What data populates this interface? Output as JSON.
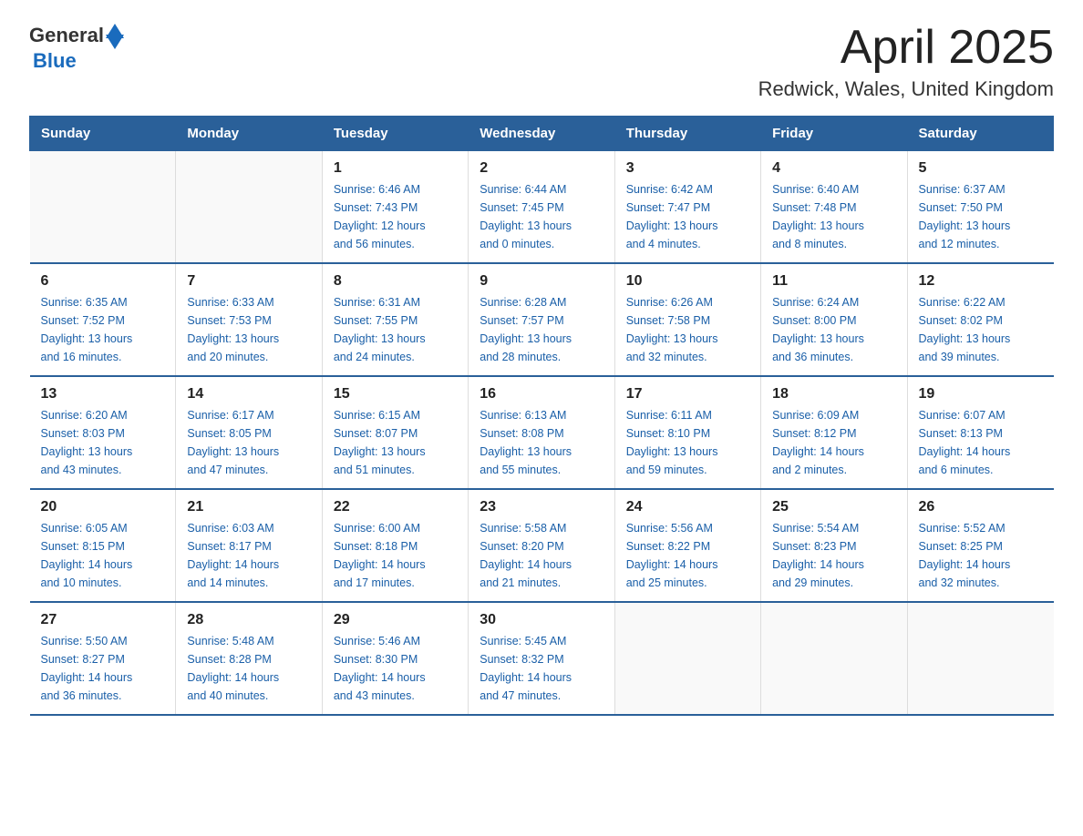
{
  "logo": {
    "text_general": "General",
    "text_blue": "Blue"
  },
  "title": "April 2025",
  "subtitle": "Redwick, Wales, United Kingdom",
  "days_of_week": [
    "Sunday",
    "Monday",
    "Tuesday",
    "Wednesday",
    "Thursday",
    "Friday",
    "Saturday"
  ],
  "weeks": [
    [
      {
        "day": "",
        "details": ""
      },
      {
        "day": "",
        "details": ""
      },
      {
        "day": "1",
        "details": "Sunrise: 6:46 AM\nSunset: 7:43 PM\nDaylight: 12 hours\nand 56 minutes."
      },
      {
        "day": "2",
        "details": "Sunrise: 6:44 AM\nSunset: 7:45 PM\nDaylight: 13 hours\nand 0 minutes."
      },
      {
        "day": "3",
        "details": "Sunrise: 6:42 AM\nSunset: 7:47 PM\nDaylight: 13 hours\nand 4 minutes."
      },
      {
        "day": "4",
        "details": "Sunrise: 6:40 AM\nSunset: 7:48 PM\nDaylight: 13 hours\nand 8 minutes."
      },
      {
        "day": "5",
        "details": "Sunrise: 6:37 AM\nSunset: 7:50 PM\nDaylight: 13 hours\nand 12 minutes."
      }
    ],
    [
      {
        "day": "6",
        "details": "Sunrise: 6:35 AM\nSunset: 7:52 PM\nDaylight: 13 hours\nand 16 minutes."
      },
      {
        "day": "7",
        "details": "Sunrise: 6:33 AM\nSunset: 7:53 PM\nDaylight: 13 hours\nand 20 minutes."
      },
      {
        "day": "8",
        "details": "Sunrise: 6:31 AM\nSunset: 7:55 PM\nDaylight: 13 hours\nand 24 minutes."
      },
      {
        "day": "9",
        "details": "Sunrise: 6:28 AM\nSunset: 7:57 PM\nDaylight: 13 hours\nand 28 minutes."
      },
      {
        "day": "10",
        "details": "Sunrise: 6:26 AM\nSunset: 7:58 PM\nDaylight: 13 hours\nand 32 minutes."
      },
      {
        "day": "11",
        "details": "Sunrise: 6:24 AM\nSunset: 8:00 PM\nDaylight: 13 hours\nand 36 minutes."
      },
      {
        "day": "12",
        "details": "Sunrise: 6:22 AM\nSunset: 8:02 PM\nDaylight: 13 hours\nand 39 minutes."
      }
    ],
    [
      {
        "day": "13",
        "details": "Sunrise: 6:20 AM\nSunset: 8:03 PM\nDaylight: 13 hours\nand 43 minutes."
      },
      {
        "day": "14",
        "details": "Sunrise: 6:17 AM\nSunset: 8:05 PM\nDaylight: 13 hours\nand 47 minutes."
      },
      {
        "day": "15",
        "details": "Sunrise: 6:15 AM\nSunset: 8:07 PM\nDaylight: 13 hours\nand 51 minutes."
      },
      {
        "day": "16",
        "details": "Sunrise: 6:13 AM\nSunset: 8:08 PM\nDaylight: 13 hours\nand 55 minutes."
      },
      {
        "day": "17",
        "details": "Sunrise: 6:11 AM\nSunset: 8:10 PM\nDaylight: 13 hours\nand 59 minutes."
      },
      {
        "day": "18",
        "details": "Sunrise: 6:09 AM\nSunset: 8:12 PM\nDaylight: 14 hours\nand 2 minutes."
      },
      {
        "day": "19",
        "details": "Sunrise: 6:07 AM\nSunset: 8:13 PM\nDaylight: 14 hours\nand 6 minutes."
      }
    ],
    [
      {
        "day": "20",
        "details": "Sunrise: 6:05 AM\nSunset: 8:15 PM\nDaylight: 14 hours\nand 10 minutes."
      },
      {
        "day": "21",
        "details": "Sunrise: 6:03 AM\nSunset: 8:17 PM\nDaylight: 14 hours\nand 14 minutes."
      },
      {
        "day": "22",
        "details": "Sunrise: 6:00 AM\nSunset: 8:18 PM\nDaylight: 14 hours\nand 17 minutes."
      },
      {
        "day": "23",
        "details": "Sunrise: 5:58 AM\nSunset: 8:20 PM\nDaylight: 14 hours\nand 21 minutes."
      },
      {
        "day": "24",
        "details": "Sunrise: 5:56 AM\nSunset: 8:22 PM\nDaylight: 14 hours\nand 25 minutes."
      },
      {
        "day": "25",
        "details": "Sunrise: 5:54 AM\nSunset: 8:23 PM\nDaylight: 14 hours\nand 29 minutes."
      },
      {
        "day": "26",
        "details": "Sunrise: 5:52 AM\nSunset: 8:25 PM\nDaylight: 14 hours\nand 32 minutes."
      }
    ],
    [
      {
        "day": "27",
        "details": "Sunrise: 5:50 AM\nSunset: 8:27 PM\nDaylight: 14 hours\nand 36 minutes."
      },
      {
        "day": "28",
        "details": "Sunrise: 5:48 AM\nSunset: 8:28 PM\nDaylight: 14 hours\nand 40 minutes."
      },
      {
        "day": "29",
        "details": "Sunrise: 5:46 AM\nSunset: 8:30 PM\nDaylight: 14 hours\nand 43 minutes."
      },
      {
        "day": "30",
        "details": "Sunrise: 5:45 AM\nSunset: 8:32 PM\nDaylight: 14 hours\nand 47 minutes."
      },
      {
        "day": "",
        "details": ""
      },
      {
        "day": "",
        "details": ""
      },
      {
        "day": "",
        "details": ""
      }
    ]
  ]
}
